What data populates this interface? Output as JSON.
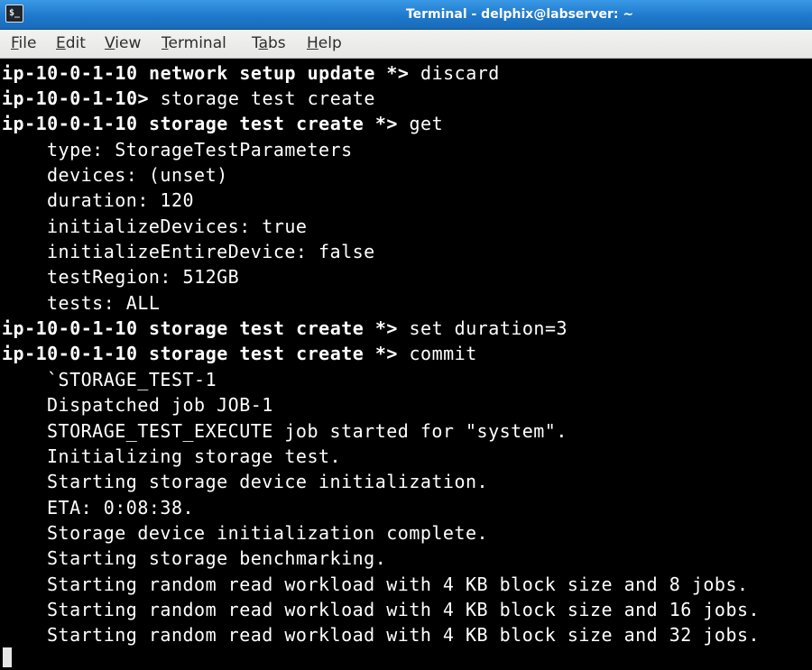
{
  "window": {
    "title": "Terminal - delphix@labserver: ~",
    "icon": "terminal-icon",
    "icon_glyph": "$_"
  },
  "menu": [
    {
      "mnemonic": "F",
      "rest": "ile"
    },
    {
      "mnemonic": "E",
      "rest": "dit"
    },
    {
      "mnemonic": "V",
      "rest": "iew"
    },
    {
      "mnemonic": "T",
      "rest": "erminal"
    },
    {
      "pre": "T",
      "mnemonic": "a",
      "rest": "bs"
    },
    {
      "mnemonic": "H",
      "rest": "elp"
    }
  ],
  "terminal": {
    "lines": [
      {
        "prompt": "ip-10-0-1-10 network setup update *> ",
        "text": "discard"
      },
      {
        "prompt": "ip-10-0-1-10> ",
        "text": "storage test create"
      },
      {
        "prompt": "ip-10-0-1-10 storage test create *> ",
        "text": "get"
      },
      {
        "text": "type: StorageTestParameters"
      },
      {
        "text": "devices: (unset)"
      },
      {
        "text": "duration: 120"
      },
      {
        "text": "initializeDevices: true"
      },
      {
        "text": "initializeEntireDevice: false"
      },
      {
        "text": "testRegion: 512GB"
      },
      {
        "text": "tests: ALL"
      },
      {
        "prompt": "ip-10-0-1-10 storage test create *> ",
        "text": "set duration=3"
      },
      {
        "prompt": "ip-10-0-1-10 storage test create *> ",
        "text": "commit"
      },
      {
        "text": "`STORAGE_TEST-1"
      },
      {
        "text": "Dispatched job JOB-1"
      },
      {
        "text": "STORAGE_TEST_EXECUTE job started for \"system\"."
      },
      {
        "text": "Initializing storage test."
      },
      {
        "text": "Starting storage device initialization."
      },
      {
        "text": "ETA: 0:08:38."
      },
      {
        "text": "Storage device initialization complete."
      },
      {
        "text": "Starting storage benchmarking."
      },
      {
        "text": "Starting random read workload with 4 KB block size and 8 jobs."
      },
      {
        "text": "Starting random read workload with 4 KB block size and 16 jobs."
      },
      {
        "text": "Starting random read workload with 4 KB block size and 32 jobs."
      }
    ]
  },
  "colors": {
    "titlebar": "#1f79cc",
    "terminal_bg": "#000000",
    "terminal_fg": "#ffffff"
  }
}
